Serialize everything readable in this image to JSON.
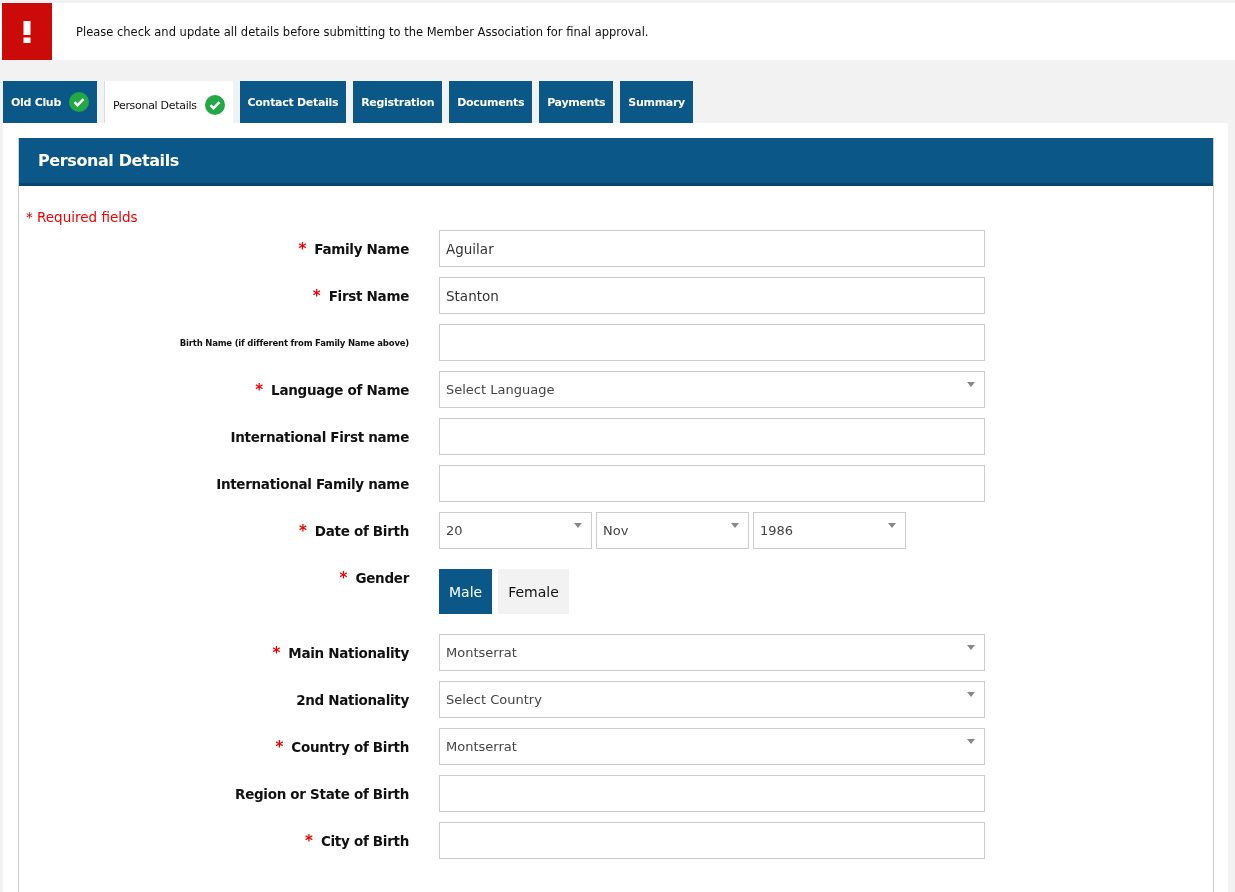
{
  "alert": {
    "message": "Please check and update all details before submitting to the Member Association for final approval."
  },
  "tabs": [
    {
      "label": "Old Club",
      "selected": false,
      "complete": true
    },
    {
      "label": "Personal Details",
      "selected": true,
      "complete": true
    },
    {
      "label": "Contact Details",
      "selected": false,
      "complete": false
    },
    {
      "label": "Registration",
      "selected": false,
      "complete": false
    },
    {
      "label": "Documents",
      "selected": false,
      "complete": false
    },
    {
      "label": "Payments",
      "selected": false,
      "complete": false
    },
    {
      "label": "Summary",
      "selected": false,
      "complete": false
    }
  ],
  "panel": {
    "title": "Personal Details",
    "required_note": "* Required fields",
    "required_symbol": "*"
  },
  "fields": [
    {
      "kind": "text",
      "label": "Family Name",
      "required": true,
      "small_label": false,
      "value": "Aguilar"
    },
    {
      "kind": "text",
      "label": "First Name",
      "required": true,
      "small_label": false,
      "value": "Stanton"
    },
    {
      "kind": "text",
      "label": "Birth Name (if different from Family Name above)",
      "required": false,
      "small_label": true
    },
    {
      "kind": "select",
      "label": "Language of Name",
      "required": true,
      "small_label": false,
      "placeholder": "Select Language"
    },
    {
      "kind": "text",
      "label": "International First name",
      "required": false,
      "small_label": false
    },
    {
      "kind": "text",
      "label": "International Family name",
      "required": false,
      "small_label": false
    },
    {
      "kind": "date",
      "label": "Date of Birth",
      "required": true,
      "small_label": false,
      "parts": [
        "20",
        "Nov",
        "1986"
      ]
    },
    {
      "kind": "choice",
      "label": "Gender",
      "required": true,
      "small_label": false,
      "options": [
        {
          "label": "Male",
          "selected": true
        },
        {
          "label": "Female",
          "selected": false
        }
      ]
    },
    {
      "kind": "select",
      "label": "Main Nationality",
      "required": true,
      "small_label": false,
      "value": "Montserrat"
    },
    {
      "kind": "select",
      "label": "2nd Nationality",
      "required": false,
      "small_label": false,
      "placeholder": "Select Country"
    },
    {
      "kind": "select",
      "label": "Country of Birth",
      "required": true,
      "small_label": false,
      "value": "Montserrat"
    },
    {
      "kind": "text",
      "label": "Region or State of Birth",
      "required": false,
      "small_label": false
    },
    {
      "kind": "text",
      "label": "City of Birth",
      "required": true,
      "small_label": false
    }
  ]
}
